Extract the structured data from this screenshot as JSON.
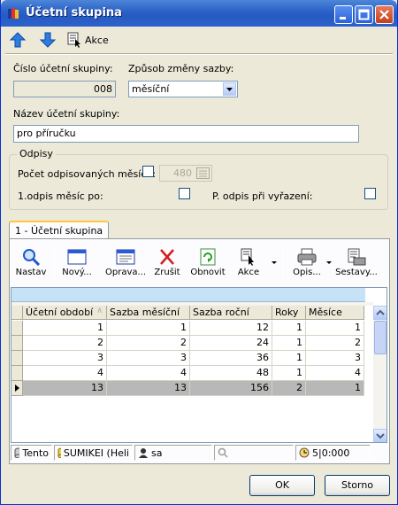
{
  "window": {
    "title": "Účetní skupina"
  },
  "toolbar": {
    "action_label": "Akce"
  },
  "form": {
    "number_label": "Číslo účetní skupiny:",
    "number_value": "008",
    "rate_change_label": "Způsob změny sazby:",
    "rate_change_value": "měsíční",
    "name_label": "Název účetní skupiny:",
    "name_value": "pro příručku"
  },
  "depreciation": {
    "title": "Odpisy",
    "months_label": "Počet odpisovaných měsíců:",
    "months_value": "480",
    "first_month_label": "1.odpis měsíc po:",
    "disposal_label": "P. odpis při vyřazení:"
  },
  "tabs": [
    {
      "label": "1 - Účetní skupina"
    }
  ],
  "grid_toolbar": {
    "find": "Nastav",
    "new": "Nový...",
    "edit": "Oprava...",
    "cancel": "Zrušit",
    "refresh": "Obnovit",
    "actions": "Akce",
    "copy": "Opis...",
    "reports": "Sestavy..."
  },
  "table": {
    "columns": [
      "Účetní období",
      "Sazba měsíční",
      "Sazba roční",
      "Roky",
      "Měsíce"
    ],
    "rows": [
      [
        "1",
        "1",
        "12",
        "1",
        "1"
      ],
      [
        "2",
        "2",
        "24",
        "1",
        "2"
      ],
      [
        "3",
        "3",
        "36",
        "1",
        "3"
      ],
      [
        "4",
        "4",
        "48",
        "1",
        "4"
      ],
      [
        "13",
        "13",
        "156",
        "2",
        "1"
      ]
    ],
    "selected_row": 4
  },
  "statusbar": {
    "pane1": "Tento",
    "pane2": "SUMIKEI (Heli",
    "pane3": "sa",
    "pane5": "5|0:000"
  },
  "buttons": {
    "ok": "OK",
    "cancel": "Storno"
  }
}
